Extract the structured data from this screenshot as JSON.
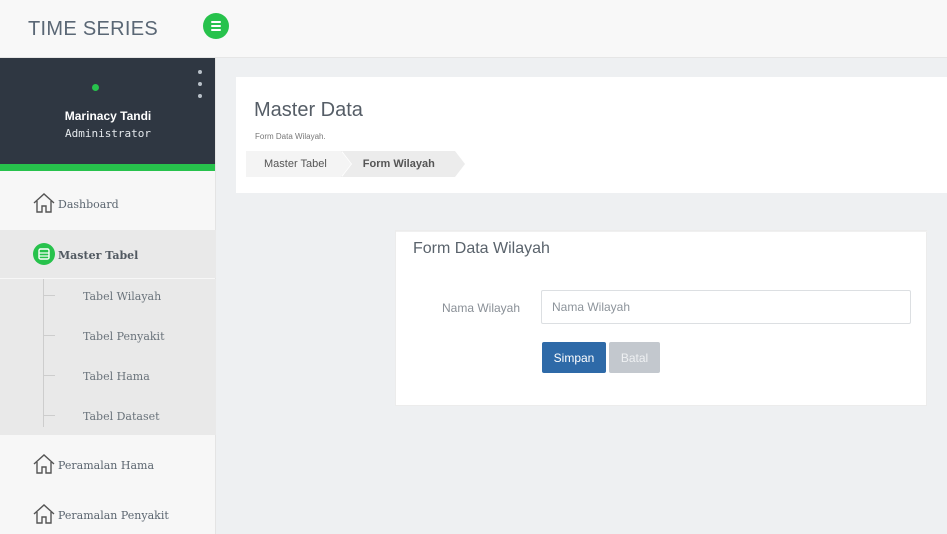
{
  "app": {
    "title": "TIME SERIES"
  },
  "colors": {
    "accent": "#27c24c",
    "primary_button": "#2e6aa8",
    "sidebar_profile_bg": "#2f3742"
  },
  "topbar": {
    "menu_icon": "hamburger-icon"
  },
  "profile": {
    "name": "Marinacy Tandi",
    "role": "Administrator",
    "status": "online",
    "options_icon": "kebab-icon"
  },
  "sidebar": {
    "dashboard": {
      "label": "Dashboard",
      "icon": "home-icon"
    },
    "master": {
      "label": "Master Tabel",
      "icon": "table-circle-icon",
      "active": true,
      "items": [
        {
          "label": "Tabel Wilayah"
        },
        {
          "label": "Tabel Penyakit"
        },
        {
          "label": "Tabel Hama"
        },
        {
          "label": "Tabel Dataset"
        }
      ]
    },
    "peramalan_hama": {
      "label": "Peramalan Hama",
      "icon": "home-icon"
    },
    "peramalan_penyakit": {
      "label": "Peramalan Penyakit",
      "icon": "home-icon"
    }
  },
  "header": {
    "title": "Master Data",
    "subtitle": "Form Data Wilayah.",
    "breadcrumb": [
      "Master Tabel",
      "Form Wilayah"
    ]
  },
  "form": {
    "title": "Form Data Wilayah",
    "field_label": "Nama Wilayah",
    "field_placeholder": "Nama Wilayah",
    "field_value": "",
    "save_label": "Simpan",
    "cancel_label": "Batal"
  }
}
